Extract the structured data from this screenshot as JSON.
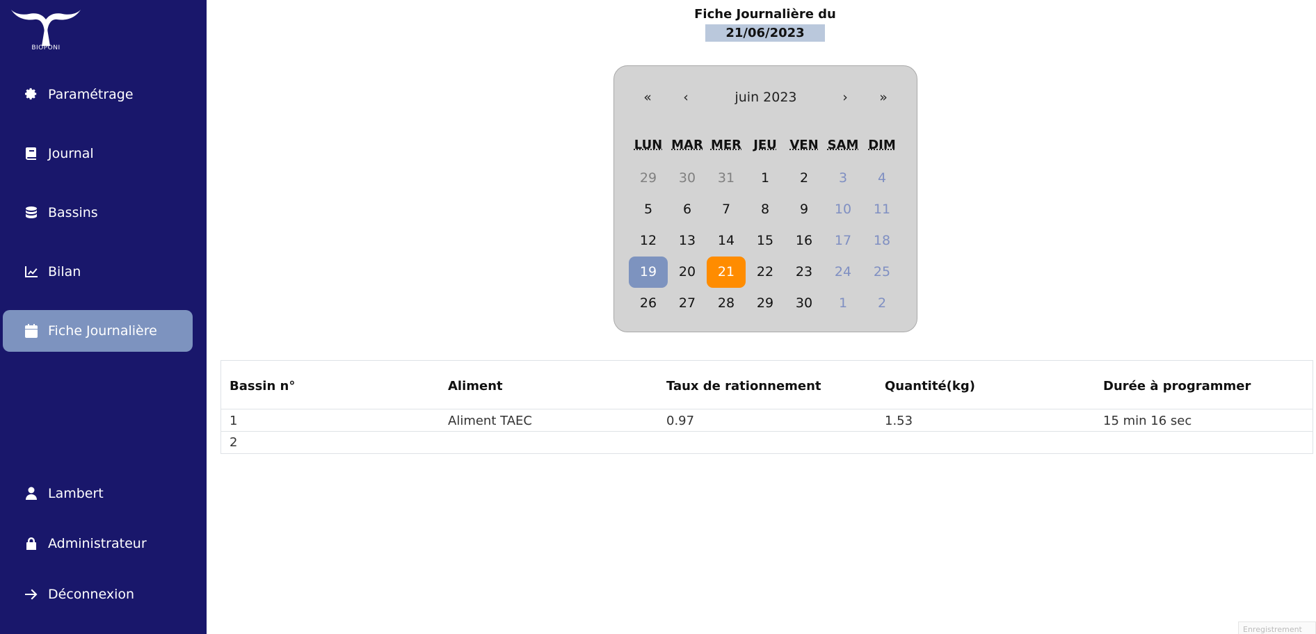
{
  "brand": {
    "name": "BIOPONI"
  },
  "sidebar": {
    "items": [
      {
        "label": "Paramétrage",
        "icon": "gear-icon"
      },
      {
        "label": "Journal",
        "icon": "book-icon"
      },
      {
        "label": "Bassins",
        "icon": "database-icon"
      },
      {
        "label": "Bilan",
        "icon": "chart-line-icon"
      },
      {
        "label": "Fiche Journalière",
        "icon": "calendar-icon",
        "active": true
      }
    ],
    "bottom": [
      {
        "label": "Lambert",
        "icon": "user-icon"
      },
      {
        "label": "Administrateur",
        "icon": "lock-icon"
      },
      {
        "label": "Déconnexion",
        "icon": "arrow-right-icon"
      }
    ]
  },
  "header": {
    "title": "Fiche Journalière du",
    "date": "21/06/2023"
  },
  "calendar": {
    "nav": {
      "prev_year": "«",
      "prev_month": "‹",
      "next_month": "›",
      "next_year": "»"
    },
    "month_label": "juin 2023",
    "weekdays": [
      "LUN",
      "MAR",
      "MER",
      "JEU",
      "VEN",
      "SAM",
      "DIM"
    ],
    "weeks": [
      [
        "29",
        "30",
        "31",
        "1",
        "2",
        "3",
        "4"
      ],
      [
        "5",
        "6",
        "7",
        "8",
        "9",
        "10",
        "11"
      ],
      [
        "12",
        "13",
        "14",
        "15",
        "16",
        "17",
        "18"
      ],
      [
        "19",
        "20",
        "21",
        "22",
        "23",
        "24",
        "25"
      ],
      [
        "26",
        "27",
        "28",
        "29",
        "30",
        "1",
        "2"
      ]
    ],
    "selected_day": "19",
    "today_day": "21",
    "colors": {
      "today": "#ff8c00",
      "selected": "#7d93bf",
      "weekend": "#7f8fc2"
    }
  },
  "table": {
    "headers": [
      "Bassin n°",
      "Aliment",
      "Taux de rationnement",
      "Quantité(kg)",
      "Durée à programmer"
    ],
    "rows": [
      [
        "1",
        "Aliment TAEC",
        "0.97",
        "1.53",
        "15 min 16 sec"
      ],
      [
        "2",
        "",
        "",
        "",
        ""
      ]
    ]
  },
  "corner_button": {
    "label": "Enregistrement"
  },
  "colors": {
    "sidebar_bg": "#19176b",
    "active_item": "#7d93bf",
    "date_box": "#bac8dc"
  }
}
